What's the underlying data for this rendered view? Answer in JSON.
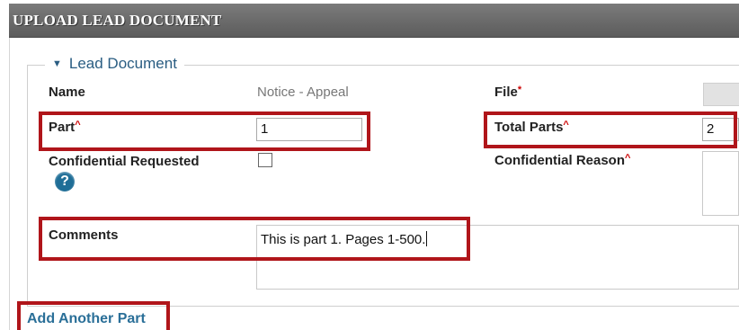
{
  "header": {
    "title": "UPLOAD LEAD DOCUMENT"
  },
  "section": {
    "legend": "Lead Document",
    "legend_icon": "caret-down-icon"
  },
  "fields": {
    "name": {
      "label": "Name",
      "value": "Notice - Appeal"
    },
    "file": {
      "label": "File",
      "required_marker": "*"
    },
    "part": {
      "label": "Part",
      "required_marker": "^",
      "value": "1"
    },
    "total_parts": {
      "label": "Total Parts",
      "required_marker": "^",
      "value": "2"
    },
    "confidential_requested": {
      "label": "Confidential Requested",
      "checked": false,
      "help_icon": "help-icon"
    },
    "confidential_reason": {
      "label": "Confidential Reason",
      "required_marker": "^",
      "value": ""
    },
    "comments": {
      "label": "Comments",
      "value": "This is part 1. Pages 1-500."
    }
  },
  "actions": {
    "add_another_part": "Add Another Part"
  },
  "colors": {
    "highlight": "#b0151a",
    "link": "#2a6f98",
    "required": "#cc0000",
    "header_bg": "#6b6b6b"
  }
}
